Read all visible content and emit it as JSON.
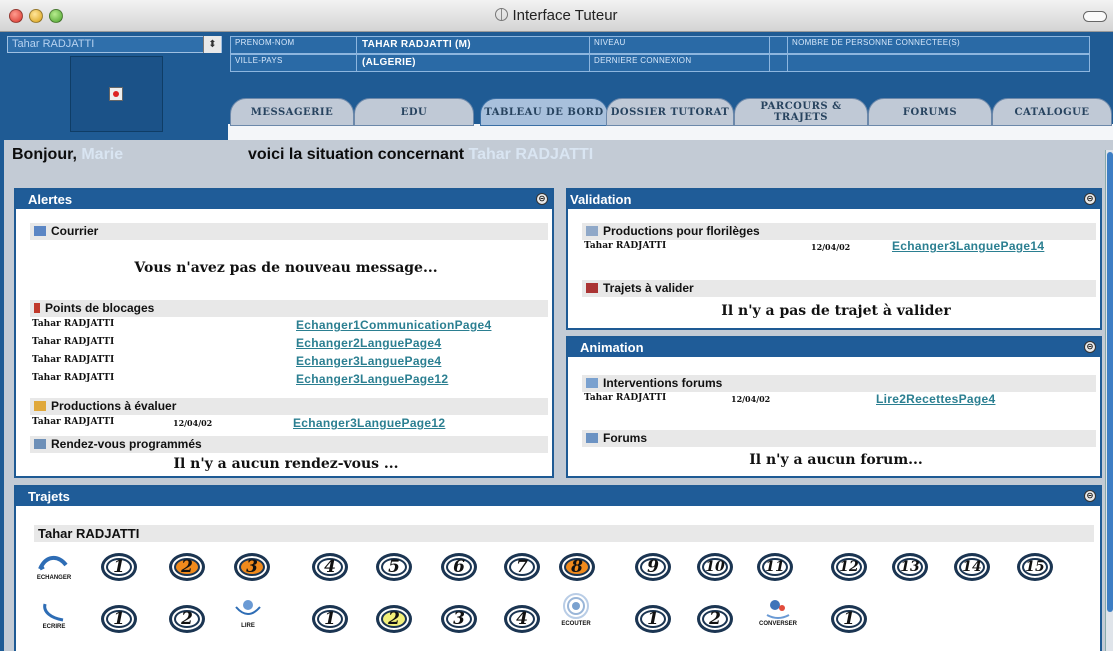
{
  "window": {
    "title": "Interface Tuteur"
  },
  "header": {
    "student_select": "Tahar RADJATTI",
    "fields": {
      "prenom_nom_label": "PRENOM-NOM",
      "prenom_nom_value": "TAHAR RADJATTI (M)",
      "ville_pays_label": "VILLE-PAYS",
      "ville_pays_value": "(ALGERIE)",
      "niveau_label": "NIVEAU",
      "derniere_connexion_label": "DERNIERE CONNEXION",
      "nombre_personnes_label": "NOMBRE DE PERSONNE CONNECTEE(S)"
    },
    "tabs": [
      {
        "label": "MESSAGERIE"
      },
      {
        "label": "EDU"
      },
      {
        "label": "TABLEAU DE BORD"
      },
      {
        "label": "DOSSIER TUTORAT"
      },
      {
        "label": "PARCOURS & TRAJETS"
      },
      {
        "label": "FORUMS"
      },
      {
        "label": "CATALOGUE"
      }
    ]
  },
  "greeting": {
    "prefix": "Bonjour,",
    "tutor": "Marie",
    "middle": "voici la situation concernant",
    "student": "Tahar RADJATTI"
  },
  "alertes": {
    "title": "Alertes",
    "courrier_label": "Courrier",
    "courrier_msg": "Vous n'avez pas de nouveau message...",
    "blocages_label": "Points de blocages",
    "blocages": [
      {
        "name": "Tahar RADJATTI",
        "link": "Echanger1CommunicationPage4"
      },
      {
        "name": "Tahar RADJATTI",
        "link": "Echanger2LanguePage4"
      },
      {
        "name": "Tahar RADJATTI",
        "link": "Echanger3LanguePage4"
      },
      {
        "name": "Tahar RADJATTI",
        "link": "Echanger3LanguePage12"
      }
    ],
    "productions_label": "Productions à évaluer",
    "productions": [
      {
        "name": "Tahar RADJATTI",
        "date": "12/04/02",
        "link": "Echanger3LanguePage12"
      }
    ],
    "rdv_label": "Rendez-vous programmés",
    "rdv_msg": "Il n'y a aucun rendez-vous ..."
  },
  "validation": {
    "title": "Validation",
    "florileges_label": "Productions pour florilèges",
    "florileges": [
      {
        "name": "Tahar RADJATTI",
        "date": "12/04/02",
        "link": "Echanger3LanguePage14"
      }
    ],
    "trajets_label": "Trajets à valider",
    "trajets_msg": "Il n'y a pas de trajet à valider"
  },
  "animation": {
    "title": "Animation",
    "interventions_label": "Interventions forums",
    "interventions": [
      {
        "name": "Tahar RADJATTI",
        "date": "12/04/02",
        "link": "Lire2RecettesPage4"
      }
    ],
    "forums_label": "Forums",
    "forums_msg": "Il n'y a aucun forum..."
  },
  "trajets": {
    "title": "Trajets",
    "student": "Tahar RADJATTI",
    "row1_icon_label": "ECHANGER",
    "row1": [
      {
        "n": "1",
        "state": "white"
      },
      {
        "n": "2",
        "state": "orange"
      },
      {
        "n": "3",
        "state": "orange"
      },
      {
        "n": "4",
        "state": "white"
      },
      {
        "n": "5",
        "state": "white"
      },
      {
        "n": "6",
        "state": "white"
      },
      {
        "n": "7",
        "state": "white"
      },
      {
        "n": "8",
        "state": "orange"
      },
      {
        "n": "9",
        "state": "white"
      },
      {
        "n": "10",
        "state": "white"
      },
      {
        "n": "11",
        "state": "white"
      },
      {
        "n": "12",
        "state": "white"
      },
      {
        "n": "13",
        "state": "white"
      },
      {
        "n": "14",
        "state": "white"
      },
      {
        "n": "15",
        "state": "white"
      }
    ],
    "row2": [
      {
        "type": "icon",
        "label": "ECRIRE",
        "icon": "pen-icon"
      },
      {
        "n": "1",
        "state": "white"
      },
      {
        "n": "2",
        "state": "white"
      },
      {
        "type": "icon",
        "label": "LIRE",
        "icon": "reader-icon"
      },
      {
        "n": "1",
        "state": "white"
      },
      {
        "n": "2",
        "state": "yellow"
      },
      {
        "n": "3",
        "state": "white"
      },
      {
        "n": "4",
        "state": "white"
      },
      {
        "type": "icon",
        "label": "ECOUTER",
        "icon": "ear-icon"
      },
      {
        "n": "1",
        "state": "white"
      },
      {
        "n": "2",
        "state": "white"
      },
      {
        "type": "icon",
        "label": "CONVERSER",
        "icon": "talk-icon"
      },
      {
        "n": "1",
        "state": "white"
      }
    ],
    "colors": {
      "orange": "#f08a1c",
      "yellow": "#f3f07a",
      "white": "#ffffff"
    }
  }
}
